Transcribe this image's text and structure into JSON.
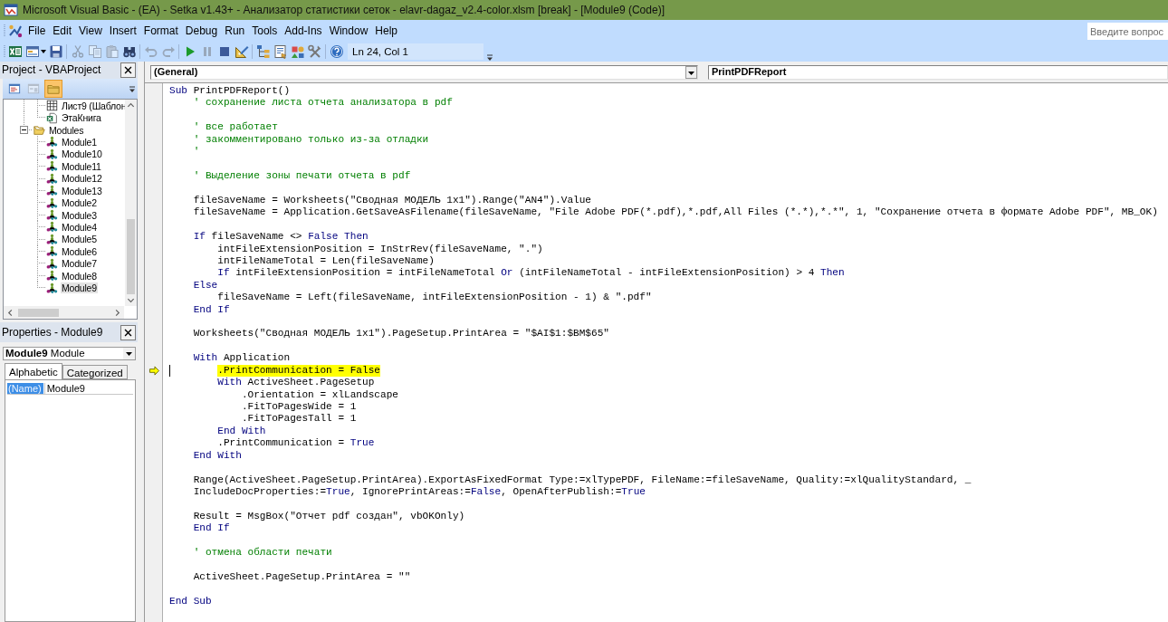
{
  "window": {
    "title": "Microsoft Visual Basic - (EA) - Setka v1.43+ - Анализатор статистики сеток - elavr-dagaz_v2.4-color.xlsm [break] - [Module9 (Code)]"
  },
  "menu_bar": {
    "items": [
      "File",
      "Edit",
      "View",
      "Insert",
      "Format",
      "Debug",
      "Run",
      "Tools",
      "Add-Ins",
      "Window",
      "Help"
    ],
    "search": {
      "placeholder": "Введите вопрос"
    }
  },
  "toolbar": {
    "groups": [
      {
        "buttons": [
          {
            "kind": "spreadsheet",
            "disabled": false
          },
          {
            "kind": "form",
            "disabled": false
          },
          {
            "kind": "save",
            "disabled": false
          }
        ]
      },
      {
        "buttons": [
          {
            "kind": "cut",
            "disabled": true
          },
          {
            "kind": "copy",
            "disabled": true
          },
          {
            "kind": "paste",
            "disabled": true
          },
          {
            "kind": "find",
            "disabled": false
          }
        ]
      },
      {
        "buttons": [
          {
            "kind": "undo",
            "disabled": true
          },
          {
            "kind": "redo",
            "disabled": true
          }
        ]
      },
      {
        "buttons": [
          {
            "kind": "run",
            "disabled": false
          },
          {
            "kind": "pause",
            "disabled": true
          },
          {
            "kind": "stop",
            "disabled": false
          },
          {
            "kind": "design",
            "disabled": false
          }
        ]
      },
      {
        "buttons": [
          {
            "kind": "explorer",
            "disabled": false
          },
          {
            "kind": "properties",
            "disabled": false
          },
          {
            "kind": "browser",
            "disabled": false
          },
          {
            "kind": "toolbox",
            "disabled": false
          }
        ]
      },
      {
        "buttons": [
          {
            "kind": "help",
            "disabled": false
          }
        ]
      }
    ],
    "position": "Ln 24, Col 1"
  },
  "project_panel": {
    "title": "Project - VBAProject",
    "toolbar": [
      {
        "kind": "code",
        "disabled": false,
        "pressed": false
      },
      {
        "kind": "object",
        "disabled": true,
        "pressed": false
      },
      {
        "kind": "folders",
        "disabled": false,
        "pressed": true
      }
    ],
    "tree": [
      {
        "children": [
          {
            "kind": "sheet",
            "label": "Лист9 (Шаблон",
            "selected": false
          },
          {
            "kind": "workbook",
            "label": "ЭтаКнига",
            "selected": false
          }
        ]
      },
      {
        "kind": "folder",
        "label": "Modules",
        "expanded": true,
        "selected": false,
        "children": [
          {
            "kind": "module",
            "label": "Module1",
            "selected": false
          },
          {
            "kind": "module",
            "label": "Module10",
            "selected": false
          },
          {
            "kind": "module",
            "label": "Module11",
            "selected": false
          },
          {
            "kind": "module",
            "label": "Module12",
            "selected": false
          },
          {
            "kind": "module",
            "label": "Module13",
            "selected": false
          },
          {
            "kind": "module",
            "label": "Module2",
            "selected": false
          },
          {
            "kind": "module",
            "label": "Module3",
            "selected": false
          },
          {
            "kind": "module",
            "label": "Module4",
            "selected": false
          },
          {
            "kind": "module",
            "label": "Module5",
            "selected": false
          },
          {
            "kind": "module",
            "label": "Module6",
            "selected": false
          },
          {
            "kind": "module",
            "label": "Module7",
            "selected": false
          },
          {
            "kind": "module",
            "label": "Module8",
            "selected": false
          },
          {
            "kind": "module",
            "label": "Module9",
            "selected": true
          }
        ]
      }
    ]
  },
  "properties_panel": {
    "title": "Properties - Module9",
    "object": "**Module9** Module",
    "tabs": [
      {
        "label": "Alphabetic",
        "selected": true
      },
      {
        "label": "Categorized",
        "selected": false
      }
    ],
    "rows": [
      {
        "name": "(Name)",
        "value": "Module9",
        "selected": true
      }
    ]
  },
  "code_window": {
    "object": "(General)",
    "procedure": "PrintPDFReport",
    "lines": [
      {
        "kind": "code",
        "current": false,
        "tokens": [
          {
            "kind": "keyword",
            "text": "Sub"
          },
          {
            "kind": "plain",
            "text": " PrintPDFReport()"
          }
        ],
        "children": [
          {
            "kind": "code",
            "current": false,
            "tokens": [
              {
                "kind": "comment",
                "text": "' сохранение листа отчета анализатора в pdf"
              }
            ]
          },
          {
            "kind": "blank"
          },
          {
            "kind": "code",
            "current": false,
            "tokens": [
              {
                "kind": "comment",
                "text": "' все работает"
              }
            ]
          },
          {
            "kind": "code",
            "current": false,
            "tokens": [
              {
                "kind": "comment",
                "text": "' закомментировано только из-за отладки"
              }
            ]
          },
          {
            "kind": "code",
            "current": false,
            "tokens": [
              {
                "kind": "comment",
                "text": "'"
              }
            ]
          },
          {
            "kind": "blank"
          },
          {
            "kind": "code",
            "current": false,
            "tokens": [
              {
                "kind": "comment",
                "text": "' Выделение зоны печати отчета в pdf"
              }
            ]
          },
          {
            "kind": "blank"
          },
          {
            "kind": "code",
            "current": false,
            "tokens": [
              {
                "kind": "plain",
                "text": "fileSaveName = Worksheets(\"Сводная МОДЕЛЬ 1x1\").Range(\"AN4\").Value"
              }
            ]
          },
          {
            "kind": "code",
            "current": false,
            "tokens": [
              {
                "kind": "plain",
                "text": "fileSaveName = Application.GetSaveAsFilename(fileSaveName, \"File Adobe PDF(*.pdf),*.pdf,All Files (*.*),*.*\", 1, \"Сохранение отчета в формате Adobe PDF\", MB_OK)"
              }
            ]
          },
          {
            "kind": "blank"
          },
          {
            "kind": "code",
            "current": false,
            "tokens": [
              {
                "kind": "keyword",
                "text": "If"
              },
              {
                "kind": "plain",
                "text": " fileSaveName <> "
              },
              {
                "kind": "keyword",
                "text": "False Then"
              }
            ],
            "children": [
              {
                "kind": "code",
                "current": false,
                "tokens": [
                  {
                    "kind": "plain",
                    "text": "intFileExtensionPosition = InStrRev(fileSaveName, \".\")"
                  }
                ]
              },
              {
                "kind": "code",
                "current": false,
                "tokens": [
                  {
                    "kind": "plain",
                    "text": "intFileNameTotal = Len(fileSaveName)"
                  }
                ]
              },
              {
                "kind": "code",
                "current": false,
                "tokens": [
                  {
                    "kind": "keyword",
                    "text": "If"
                  },
                  {
                    "kind": "plain",
                    "text": " intFileExtensionPosition = intFileNameTotal "
                  },
                  {
                    "kind": "keyword",
                    "text": "Or"
                  },
                  {
                    "kind": "plain",
                    "text": " (intFileNameTotal - intFileExtensionPosition) > 4 "
                  },
                  {
                    "kind": "keyword",
                    "text": "Then"
                  }
                ]
              }
            ]
          },
          {
            "kind": "code",
            "current": false,
            "tokens": [
              {
                "kind": "keyword",
                "text": "Else"
              }
            ],
            "children": [
              {
                "kind": "code",
                "current": false,
                "tokens": [
                  {
                    "kind": "plain",
                    "text": "fileSaveName = Left(fileSaveName, intFileExtensionPosition - 1) & \".pdf\""
                  }
                ]
              }
            ]
          },
          {
            "kind": "code",
            "current": false,
            "tokens": [
              {
                "kind": "keyword",
                "text": "End If"
              }
            ]
          },
          {
            "kind": "blank"
          },
          {
            "kind": "code",
            "current": false,
            "tokens": [
              {
                "kind": "plain",
                "text": "Worksheets(\"Сводная МОДЕЛЬ 1x1\").PageSetup.PrintArea = \"$AI$1:$BM$65\""
              }
            ]
          },
          {
            "kind": "blank"
          },
          {
            "kind": "code",
            "current": false,
            "tokens": [
              {
                "kind": "keyword",
                "text": "With"
              },
              {
                "kind": "plain",
                "text": " Application"
              }
            ],
            "children": [
              {
                "kind": "code",
                "current": true,
                "tokens": [
                  {
                    "kind": "plain",
                    "text": ".PrintCommunication = False"
                  }
                ]
              },
              {
                "kind": "code",
                "current": false,
                "tokens": [
                  {
                    "kind": "keyword",
                    "text": "With"
                  },
                  {
                    "kind": "plain",
                    "text": " ActiveSheet.PageSetup"
                  }
                ],
                "children": [
                  {
                    "kind": "code",
                    "current": false,
                    "tokens": [
                      {
                        "kind": "plain",
                        "text": ".Orientation = xlLandscape"
                      }
                    ]
                  },
                  {
                    "kind": "code",
                    "current": false,
                    "tokens": [
                      {
                        "kind": "plain",
                        "text": ".FitToPagesWide = 1"
                      }
                    ]
                  },
                  {
                    "kind": "code",
                    "current": false,
                    "tokens": [
                      {
                        "kind": "plain",
                        "text": ".FitToPagesTall = 1"
                      }
                    ]
                  }
                ]
              },
              {
                "kind": "code",
                "current": false,
                "tokens": [
                  {
                    "kind": "keyword",
                    "text": "End With"
                  }
                ]
              },
              {
                "kind": "code",
                "current": false,
                "tokens": [
                  {
                    "kind": "plain",
                    "text": ".PrintCommunication = "
                  },
                  {
                    "kind": "keyword",
                    "text": "True"
                  }
                ]
              }
            ]
          },
          {
            "kind": "code",
            "current": false,
            "tokens": [
              {
                "kind": "keyword",
                "text": "End With"
              }
            ]
          },
          {
            "kind": "blank"
          },
          {
            "kind": "code",
            "current": false,
            "tokens": [
              {
                "kind": "plain",
                "text": "Range(ActiveSheet.PageSetup.PrintArea).ExportAsFixedFormat Type:=xlTypePDF, FileName:=fileSaveName, Quality:=xlQualityStandard, _"
              }
            ]
          },
          {
            "kind": "code",
            "current": false,
            "tokens": [
              {
                "kind": "plain",
                "text": "IncludeDocProperties:="
              },
              {
                "kind": "keyword",
                "text": "True"
              },
              {
                "kind": "plain",
                "text": ", IgnorePrintAreas:="
              },
              {
                "kind": "keyword",
                "text": "False"
              },
              {
                "kind": "plain",
                "text": ", OpenAfterPublish:="
              },
              {
                "kind": "keyword",
                "text": "True"
              }
            ]
          },
          {
            "kind": "blank"
          },
          {
            "kind": "code",
            "current": false,
            "tokens": [
              {
                "kind": "plain",
                "text": "Result = MsgBox(\"Отчет pdf создан\", vbOKOnly)"
              }
            ]
          },
          {
            "kind": "code",
            "current": false,
            "tokens": [
              {
                "kind": "keyword",
                "text": "End If"
              }
            ]
          },
          {
            "kind": "blank"
          },
          {
            "kind": "code",
            "current": false,
            "tokens": [
              {
                "kind": "comment",
                "text": "' отмена области печати"
              }
            ]
          },
          {
            "kind": "blank"
          },
          {
            "kind": "code",
            "current": false,
            "tokens": [
              {
                "kind": "plain",
                "text": "ActiveSheet.PageSetup.PrintArea = \"\""
              }
            ]
          },
          {
            "kind": "blank"
          }
        ]
      },
      {
        "kind": "code",
        "current": false,
        "tokens": [
          {
            "kind": "keyword",
            "text": "End Sub"
          }
        ]
      }
    ]
  }
}
